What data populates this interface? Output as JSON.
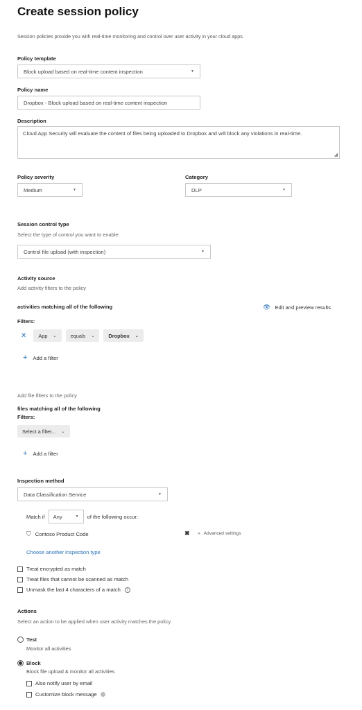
{
  "page": {
    "title": "Create session policy",
    "description": "Session policies provide you with real-time monitoring and control over user activity in your cloud apps."
  },
  "policy_template": {
    "label": "Policy template",
    "value": "Block upload based on real-time content inspection"
  },
  "policy_name": {
    "label": "Policy name",
    "value": "Dropbox - Block upload based on real-time content inspection"
  },
  "description_field": {
    "label": "Description",
    "value": "Cloud App Security will evaluate the content of files being uploaded to Dropbox and will block any violations in real-time."
  },
  "severity": {
    "label": "Policy severity",
    "value": "Medium"
  },
  "category": {
    "label": "Category",
    "value": "DLP"
  },
  "session_control": {
    "label": "Session control type",
    "sub": "Select the type of control you want to enable:",
    "value": "Control file upload (with inspection)"
  },
  "activity_source": {
    "label": "Activity source",
    "sub": "Add activity filters to the policy",
    "matching": "activities matching all of the following",
    "edit_preview": "Edit and preview results",
    "filters_label": "Filters:",
    "filter": {
      "field": "App",
      "operator": "equals",
      "value": "Dropbox"
    },
    "add_filter": "Add a filter"
  },
  "file_filters": {
    "sub": "Add file filters to the policy",
    "matching": "files matching all of the following",
    "filters_label": "Filters:",
    "select_placeholder": "Select a filter...",
    "add_filter": "Add a filter"
  },
  "inspection": {
    "label": "Inspection method",
    "value": "Data Classification Service",
    "match_if": "Match if",
    "match_value": "Any",
    "match_suffix": "of the following occur:",
    "item": "Contoso Product Code",
    "advanced": "Advanced settings",
    "choose_another": "Choose another inspection type",
    "options": [
      "Treat encrypted as match",
      "Treat files that cannot be scanned as match",
      "Unmask the last 4 characters of a match"
    ]
  },
  "actions": {
    "label": "Actions",
    "sub": "Select an action to be applied when user activity matches the policy.",
    "test": {
      "title": "Test",
      "desc": "Monitor all activities"
    },
    "block": {
      "title": "Block",
      "desc": "Block file upload & monitor all activities",
      "options": [
        "Also notify user by email",
        "Customize block message"
      ]
    }
  }
}
